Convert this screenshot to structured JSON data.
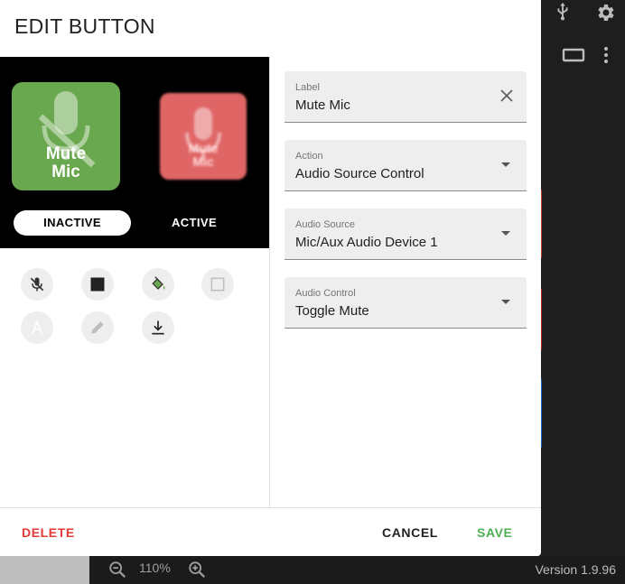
{
  "dialog": {
    "title": "EDIT BUTTON",
    "preview": {
      "inactive_button_text_line1": "Mute",
      "inactive_button_text_line2": "Mic",
      "active_button_text_line1": "Mute",
      "active_button_text_line2": "Mic",
      "inactive_tab": "INACTIVE",
      "active_tab": "ACTIVE",
      "inactive_color": "#6aa84f",
      "active_color": "#e06666"
    },
    "tools": [
      {
        "icon": "mic-off-icon"
      },
      {
        "icon": "square-filled-icon"
      },
      {
        "icon": "paint-bucket-icon"
      },
      {
        "icon": "square-outline-icon"
      },
      {
        "icon": "text-color-icon"
      },
      {
        "icon": "pencil-icon"
      },
      {
        "icon": "download-icon"
      }
    ],
    "fields": {
      "label": {
        "label": "Label",
        "value": "Mute Mic"
      },
      "action": {
        "label": "Action",
        "value": "Audio Source Control"
      },
      "audio_source": {
        "label": "Audio Source",
        "value": "Mic/Aux Audio Device 1"
      },
      "audio_control": {
        "label": "Audio Control",
        "value": "Toggle Mute"
      }
    },
    "actions": {
      "delete": "DELETE",
      "cancel": "CANCEL",
      "save": "SAVE"
    }
  },
  "background": {
    "zoom_level": "110%",
    "version": "Version 1.9.96"
  }
}
